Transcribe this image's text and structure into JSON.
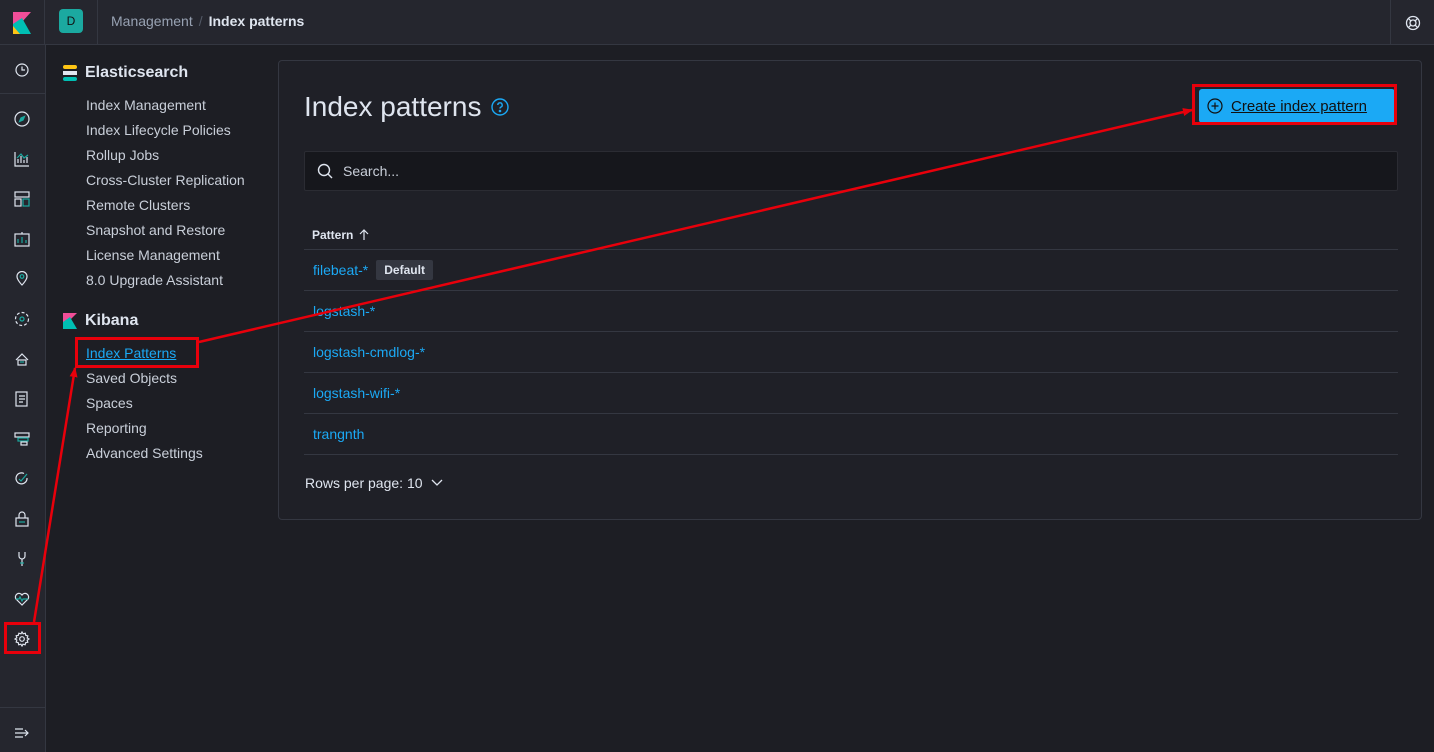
{
  "header": {
    "space_initial": "D",
    "breadcrumbs": [
      "Management",
      "Index patterns"
    ]
  },
  "nav_icons": [
    "clock-icon",
    "compass-icon",
    "visualize-icon",
    "dashboard-icon",
    "canvas-icon",
    "maps-icon",
    "ml-icon",
    "infrastructure-icon",
    "logs-icon",
    "apm-icon",
    "uptime-icon",
    "siem-icon",
    "devtools-icon",
    "monitoring-icon",
    "gear-icon",
    "collapse-icon"
  ],
  "sidebar": {
    "elasticsearch": {
      "title": "Elasticsearch",
      "items": [
        "Index Management",
        "Index Lifecycle Policies",
        "Rollup Jobs",
        "Cross-Cluster Replication",
        "Remote Clusters",
        "Snapshot and Restore",
        "License Management",
        "8.0 Upgrade Assistant"
      ]
    },
    "kibana": {
      "title": "Kibana",
      "items": [
        "Index Patterns",
        "Saved Objects",
        "Spaces",
        "Reporting",
        "Advanced Settings"
      ],
      "active": "Index Patterns"
    }
  },
  "main": {
    "title": "Index patterns",
    "create_button": "Create index pattern",
    "search_placeholder": "Search...",
    "table": {
      "column": "Pattern",
      "rows": [
        {
          "pattern": "filebeat-*",
          "badge": "Default"
        },
        {
          "pattern": "logstash-*"
        },
        {
          "pattern": "logstash-cmdlog-*"
        },
        {
          "pattern": "logstash-wifi-*"
        },
        {
          "pattern": "trangnth"
        }
      ]
    },
    "rows_per_page": "Rows per page: 10"
  },
  "colors": {
    "accent": "#1ba9f5",
    "annotation": "#e8000b",
    "background": "#1d1e24"
  }
}
